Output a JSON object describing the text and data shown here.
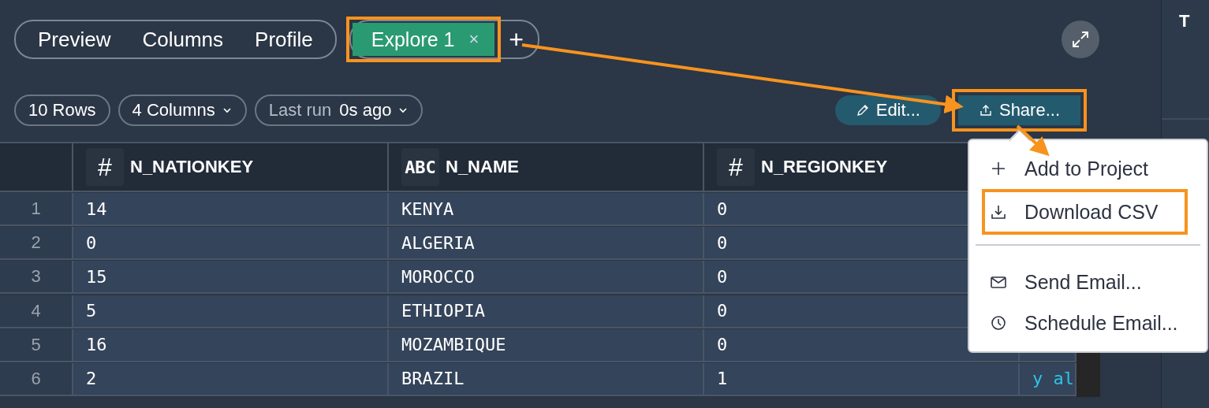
{
  "view_tabs": [
    {
      "label": "Preview",
      "selected": false
    },
    {
      "label": "Columns",
      "selected": false
    },
    {
      "label": "Profile",
      "selected": false
    }
  ],
  "explore_tabs": [
    {
      "label": "Explore 1",
      "close": "×",
      "selected": true,
      "highlighted": true
    }
  ],
  "add_tab": "+",
  "toolbar": {
    "rows": "10 Rows",
    "columns": "4 Columns",
    "last_run_label": "Last run",
    "last_run_value": "0s ago"
  },
  "actions": [
    {
      "label": "Edit...",
      "kind": "edit",
      "highlighted": false
    },
    {
      "label": "Share...",
      "kind": "share",
      "highlighted": true
    }
  ],
  "table": {
    "columns": [
      {
        "name": "N_NATIONKEY",
        "kind": "number",
        "type_label": "#"
      },
      {
        "name": "N_NAME",
        "kind": "text",
        "type_label": "ABC"
      },
      {
        "name": "N_REGIONKEY",
        "kind": "number",
        "type_label": "#"
      }
    ],
    "rows": [
      {
        "index": "1",
        "cells": [
          "14",
          "KENYA",
          "0"
        ]
      },
      {
        "index": "2",
        "cells": [
          "0",
          "ALGERIA",
          "0"
        ]
      },
      {
        "index": "3",
        "cells": [
          "15",
          "MOROCCO",
          "0"
        ]
      },
      {
        "index": "4",
        "cells": [
          "5",
          "ETHIOPIA",
          "0"
        ]
      },
      {
        "index": "5",
        "cells": [
          "16",
          "MOZAMBIQUE",
          "0"
        ]
      },
      {
        "index": "6",
        "cells": [
          "2",
          "BRAZIL",
          "1"
        ],
        "column_4": "y al"
      }
    ]
  },
  "share_menu": [
    {
      "label": "Add to Project",
      "kind": "add",
      "highlighted": false
    },
    {
      "label": "Download CSV",
      "kind": "download",
      "highlighted": true
    },
    {
      "kind": "divider"
    },
    {
      "label": "Send Email...",
      "kind": "email",
      "highlighted": false
    },
    {
      "label": "Schedule Email...",
      "kind": "schedule",
      "highlighted": false
    }
  ],
  "side_panel": {
    "title": "T"
  }
}
